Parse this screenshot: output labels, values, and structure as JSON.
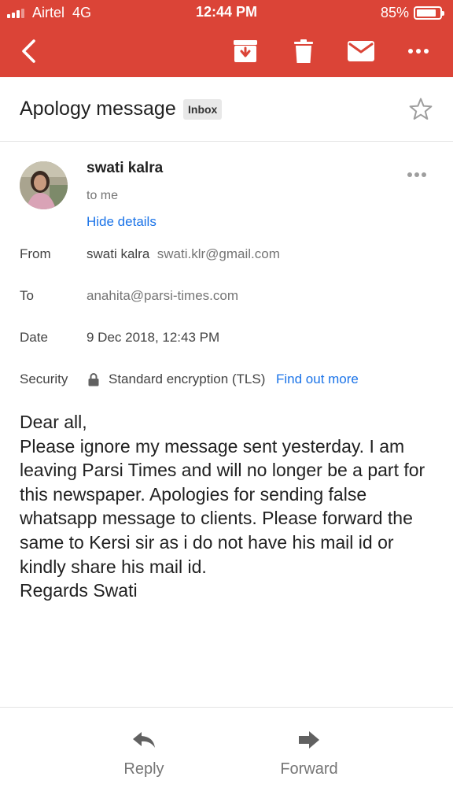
{
  "status_bar": {
    "carrier": "Airtel",
    "network": "4G",
    "time": "12:44 PM",
    "battery": "85%",
    "battery_level": 0.85,
    "signal_bars": 3
  },
  "toolbar": {
    "icons": [
      "back-icon",
      "archive-icon",
      "trash-icon",
      "mail-icon",
      "more-icon"
    ],
    "accent_color": "#db4437"
  },
  "email": {
    "subject": "Apology message",
    "label": "Inbox",
    "sender": {
      "name": "swati kalra",
      "recipient_summary": "to me",
      "hide_details": "Hide details"
    },
    "details": {
      "from_label": "From",
      "from_name": "swati kalra",
      "from_email": "swati.klr@gmail.com",
      "to_label": "To",
      "to_value": "anahita@parsi-times.com",
      "date_label": "Date",
      "date_value": "9 Dec 2018, 12:43 PM",
      "security_label": "Security",
      "security_value": "Standard encryption (TLS)",
      "security_link": "Find out more"
    },
    "body": "Dear all,\nPlease ignore my message sent yesterday. I am leaving Parsi Times and will no longer be a part for this newspaper.  Apologies for sending false whatsapp message to clients. Please forward the same to Kersi sir as i do not have his mail id or kindly share his mail id.\nRegards Swati"
  },
  "actions": {
    "reply": "Reply",
    "forward": "Forward"
  }
}
